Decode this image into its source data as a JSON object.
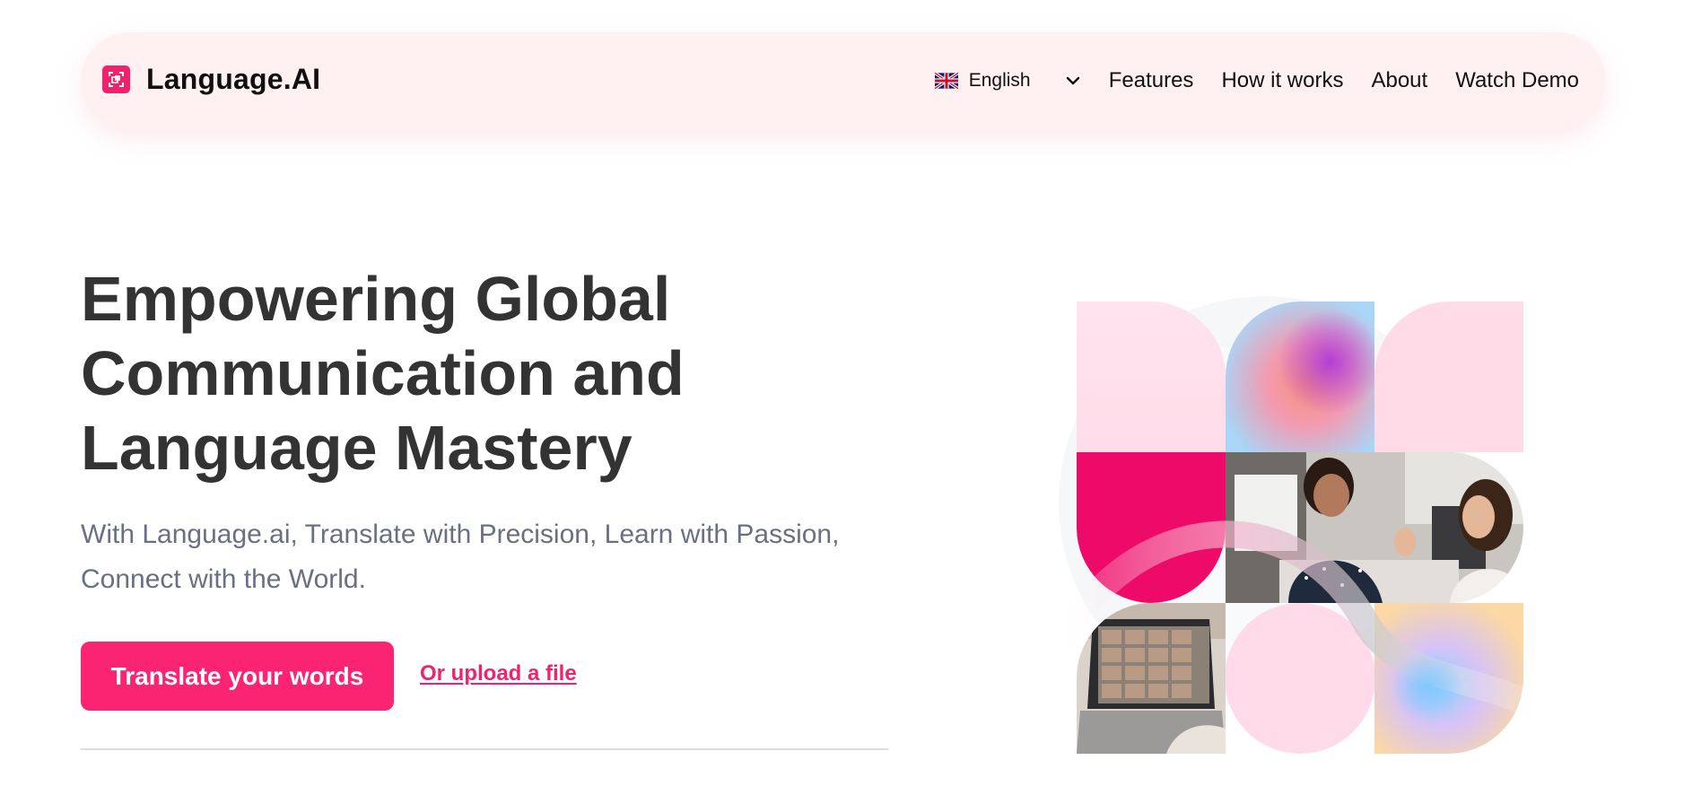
{
  "brand": {
    "name": "Language.AI",
    "icon": "translate-logo-icon",
    "accent_color": "#f0226e"
  },
  "nav": {
    "language": {
      "flag_icon": "uk-flag-icon",
      "selected": "English",
      "chevron_icon": "chevron-down-icon"
    },
    "links": [
      {
        "label": "Features"
      },
      {
        "label": "How it works"
      },
      {
        "label": "About"
      },
      {
        "label": "Watch Demo"
      }
    ]
  },
  "hero": {
    "title": "Empowering Global Communication and Language Mastery",
    "subtitle": "With Language.ai, Translate with Precision, Learn with Passion, Connect with the World.",
    "primary_cta": "Translate your words",
    "secondary_cta": "Or upload a file",
    "primary_color": "#fb2472"
  },
  "collage": {
    "images": [
      "gradient-blob-tile",
      "women-conversation-photo",
      "video-call-laptop-photo"
    ]
  }
}
